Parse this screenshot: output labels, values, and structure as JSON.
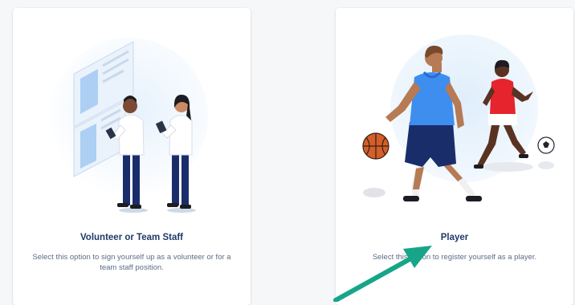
{
  "options": [
    {
      "title": "Volunteer or Team Staff",
      "description": "Select this option to sign yourself up as a volunteer or for a team staff position.",
      "illustration": "volunteer-staff-illustration"
    },
    {
      "title": "Player",
      "description": "Select this option to register yourself as a player.",
      "illustration": "basketball-soccer-players-illustration"
    }
  ],
  "annotation": {
    "icon": "arrow-pointer-icon",
    "color": "#17a589"
  },
  "colors": {
    "title": "#1f3a68",
    "description": "#5d6d86",
    "illustration_bg": "#dfeefb",
    "jersey_blue": "#3e8ef0",
    "jersey_red": "#e5242e",
    "shorts_navy": "#1a2d6b"
  }
}
